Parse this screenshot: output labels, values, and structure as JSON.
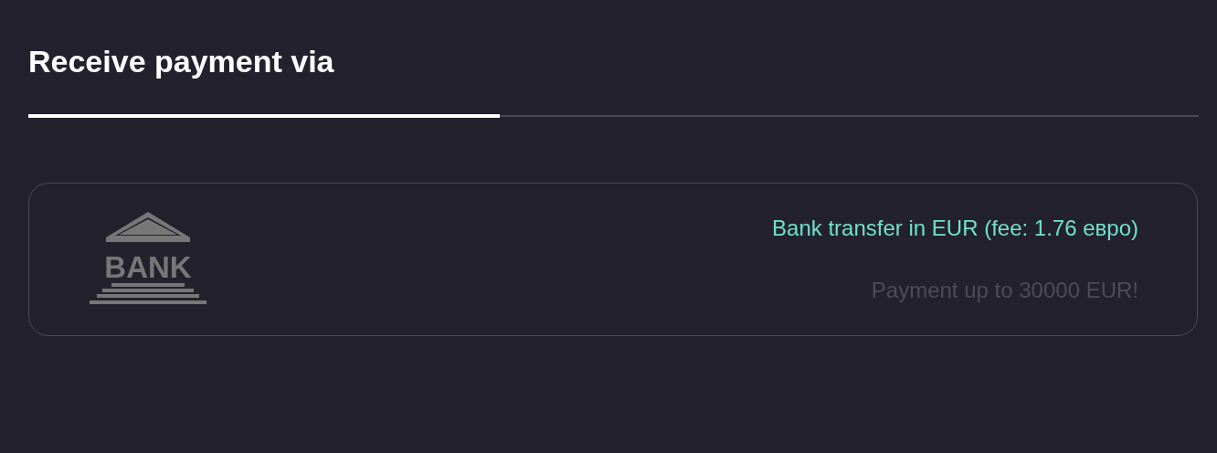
{
  "title": "Receive payment via",
  "progress": {
    "level": 0.403
  },
  "methods": [
    {
      "logo_text": "BANK",
      "name": "Bank transfer in EUR (fee: 1.76 евро)",
      "note": "Payment up to 30000 EUR!"
    }
  ]
}
